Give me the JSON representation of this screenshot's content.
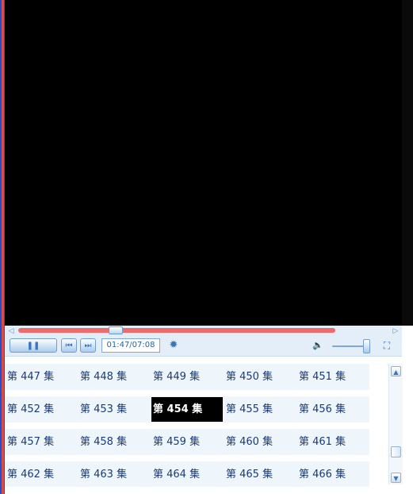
{
  "player": {
    "time_display": "01:47/07:08",
    "progress": 0.28,
    "volume_level": 0.9,
    "icons": {
      "seek_left": "seek-left-icon",
      "seek_right": "seek-right-icon",
      "pause": "pause-icon",
      "previous": "previous-icon",
      "next": "next-icon",
      "settings": "settings-icon",
      "volume": "volume-icon",
      "fullscreen": "fullscreen-icon"
    },
    "colors": {
      "progress_bar": "#ee6b6b",
      "control_accent": "#3a74c0",
      "video_background": "#000000"
    }
  },
  "episodes": {
    "rows": [
      [
        "第 447 集",
        "第 448 集",
        "第 449 集",
        "第 450 集",
        "第 451 集"
      ],
      [
        "第 452 集",
        "第 453 集",
        "第 454 集",
        "第 455 集",
        "第 456 集"
      ],
      [
        "第 457 集",
        "第 458 集",
        "第 459 集",
        "第 460 集",
        "第 461 集"
      ],
      [
        "第 462 集",
        "第 463 集",
        "第 464 集",
        "第 465 集",
        "第 466 集"
      ]
    ],
    "active": "第 454 集"
  }
}
